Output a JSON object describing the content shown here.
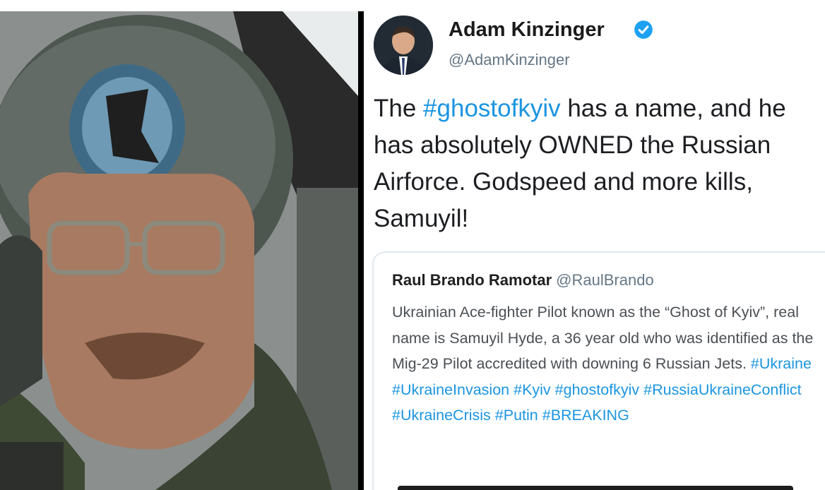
{
  "tweet": {
    "author_name": "Adam Kinzinger",
    "author_handle": "@AdamKinzinger",
    "verified_icon": "verified-badge-icon",
    "text_segments": [
      {
        "text": "The ",
        "hashtag": false
      },
      {
        "text": "#ghostofkyiv",
        "hashtag": true
      },
      {
        "text": " has a name, and he has absolutely OWNED the Russian Airforce.  Godspeed and more kills, Samuyil!",
        "hashtag": false
      }
    ]
  },
  "quoted_tweet": {
    "author_name": "Raul Brando Ramotar",
    "author_handle": "@RaulBrando",
    "text_segments": [
      {
        "text": "Ukrainian Ace-fighter Pilot known as the “Ghost of Kyiv”, real name is Samuyil Hyde, a 36 year old who was identified as the Mig-29 Pilot accredited with downing 6 Russian Jets. ",
        "hashtag": false
      },
      {
        "text": "#Ukraine",
        "hashtag": true
      },
      {
        "text": " ",
        "hashtag": false
      },
      {
        "text": "#UkraineInvasion",
        "hashtag": true
      },
      {
        "text": " ",
        "hashtag": false
      },
      {
        "text": "#Kyiv",
        "hashtag": true
      },
      {
        "text": " ",
        "hashtag": false
      },
      {
        "text": "#ghostofkyiv",
        "hashtag": true
      },
      {
        "text": " ",
        "hashtag": false
      },
      {
        "text": "#RussiaUkraineConflict",
        "hashtag": true
      },
      {
        "text": " ",
        "hashtag": false
      },
      {
        "text": "#UkraineCrisis",
        "hashtag": true
      },
      {
        "text": " ",
        "hashtag": false
      },
      {
        "text": "#Putin",
        "hashtag": true
      },
      {
        "text": " ",
        "hashtag": false
      },
      {
        "text": "#BREAKING",
        "hashtag": true
      }
    ]
  },
  "colors": {
    "hashtag": "#1b95e0",
    "handle": "#657786",
    "verified": "#1da1f2",
    "card_border": "#e1e8ed"
  }
}
